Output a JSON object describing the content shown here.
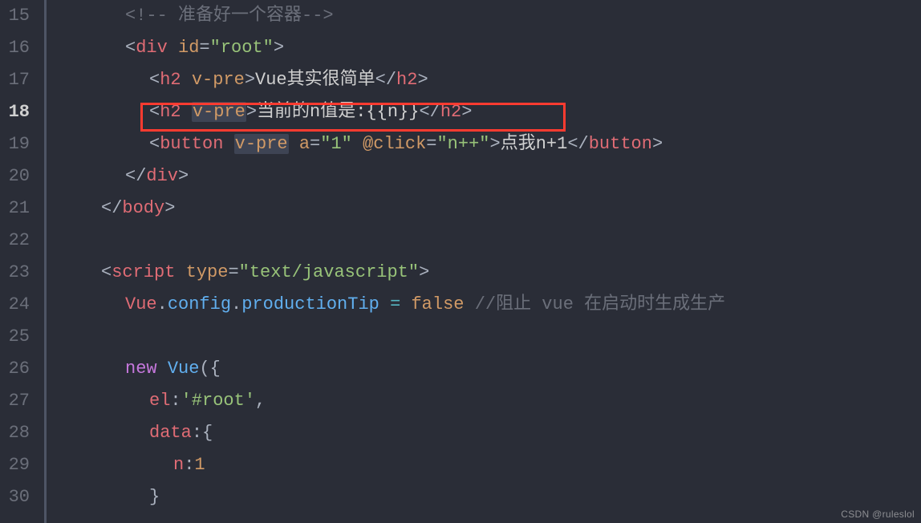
{
  "gutter": {
    "15": "15",
    "16": "16",
    "17": "17",
    "18": "18",
    "19": "19",
    "20": "20",
    "21": "21",
    "22": "22",
    "23": "23",
    "24": "24",
    "25": "25",
    "26": "26",
    "27": "27",
    "28": "28",
    "29": "29",
    "30": "30"
  },
  "code": {
    "l15_comment": "准备好一个容器",
    "l16_div": "div",
    "l16_id": "id",
    "l16_root": "\"root\"",
    "l17_h2": "h2",
    "l17_vpre": "v-pre",
    "l17_text": "Vue其实很简单",
    "l18_h2": "h2",
    "l18_vpre": "v-pre",
    "l18_text": "当前的n值是:{{n}}",
    "l19_button": "button",
    "l19_vpre": "v-pre",
    "l19_a": "a",
    "l19_aval": "\"1\"",
    "l19_click": "@click",
    "l19_clickval": "\"n++\"",
    "l19_text": "点我n+1",
    "l20_div": "div",
    "l21_body": "body",
    "l23_script": "script",
    "l23_type": "type",
    "l23_typeval": "\"text/javascript\"",
    "l24_vue": "Vue",
    "l24_config": "config",
    "l24_tip": "productionTip",
    "l24_false": "false",
    "l24_comment": "阻止 vue 在启动时生成生产",
    "l26_new": "new",
    "l26_vue": "Vue",
    "l27_el": "el",
    "l27_elval": "'#root'",
    "l28_data": "data",
    "l29_n": "n",
    "l29_nval": "1"
  },
  "watermark": "CSDN @ruleslol",
  "active_line": "18"
}
